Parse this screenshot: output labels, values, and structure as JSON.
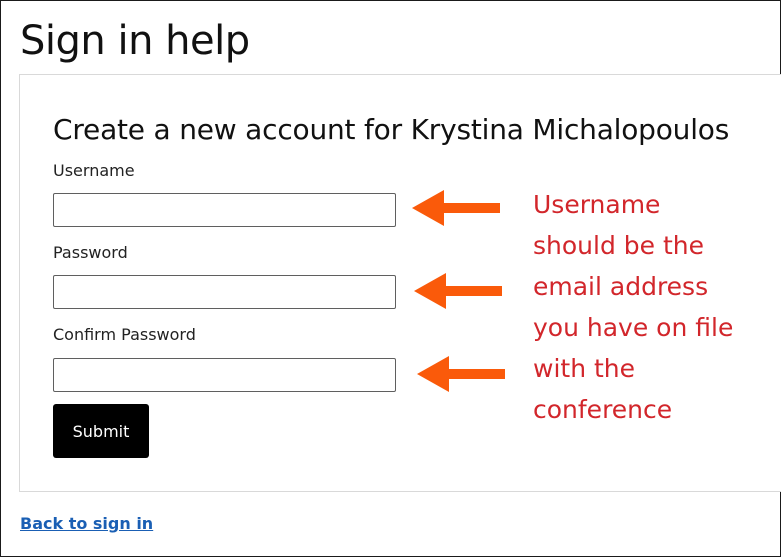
{
  "page": {
    "title": "Sign in help"
  },
  "form": {
    "title": "Create a new account for Krystina Michalopoulos",
    "fields": [
      {
        "label": "Username",
        "value": "",
        "placeholder": ""
      },
      {
        "label": "Password",
        "value": "",
        "placeholder": ""
      },
      {
        "label": "Confirm Password",
        "value": "",
        "placeholder": ""
      }
    ],
    "submit_label": "Submit"
  },
  "annotation": {
    "lines": [
      "Username",
      "should be the",
      "email address",
      "you have on file",
      "with the",
      "conference"
    ],
    "color": "#d2262b",
    "arrow_color": "#fa5a0a"
  },
  "footer": {
    "back_link_label": "Back to sign in"
  }
}
